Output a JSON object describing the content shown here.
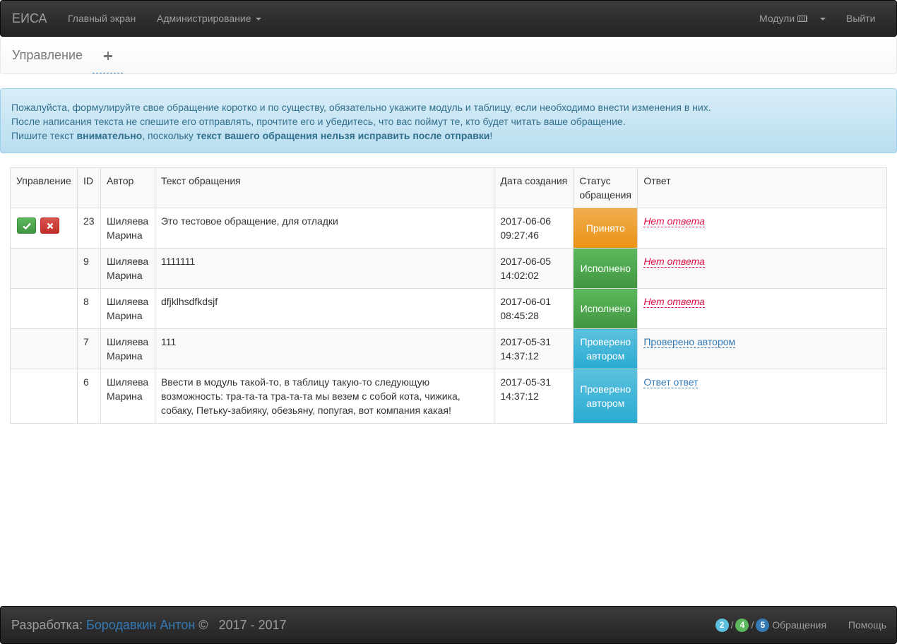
{
  "navbar": {
    "brand": "ЕИСА",
    "home": "Главный экран",
    "admin": "Администрирование",
    "modules": "Модули",
    "logout": "Выйти"
  },
  "subnav": {
    "title": "Управление"
  },
  "alert": {
    "line1": "Пожалуйста, формулируйте свое обращение коротко и по существу, обязательно укажите модуль и таблицу, если необходимо внести изменения в них.",
    "line2": "После написания текста не спешите его отправлять, прочтите его и убедитесь, что вас поймут те, кто будет читать ваше обращение.",
    "line3_a": "Пишите текст ",
    "line3_b": "внимательно",
    "line3_c": ", поскольку ",
    "line3_d": "текст вашего обращения нельзя исправить после отправки",
    "line3_e": "!"
  },
  "table": {
    "headers": [
      "Управление",
      "ID",
      "Автор",
      "Текст обращения",
      "Дата создания",
      "Статус обращения",
      "Ответ"
    ],
    "rows": [
      {
        "id": "23",
        "author": "Шиляева Марина",
        "text": "Это тестовое обращение, для отладки",
        "date": "2017-06-06 09:27:46",
        "status": "Принято",
        "answer": "Нет ответа"
      },
      {
        "id": "9",
        "author": "Шиляева Марина",
        "text": "1111111",
        "date": "2017-06-05 14:02:02",
        "status": "Исполнено",
        "answer": "Нет ответа"
      },
      {
        "id": "8",
        "author": "Шиляева Марина",
        "text": "dfjklhsdfkdsjf",
        "date": "2017-06-01 08:45:28",
        "status": "Исполнено",
        "answer": "Нет ответа"
      },
      {
        "id": "7",
        "author": "Шиляева Марина",
        "text": "111",
        "date": "2017-05-31 14:37:12",
        "status": "Проверено автором",
        "answer": "Проверено автором"
      },
      {
        "id": "6",
        "author": "Шиляева Марина",
        "text": "Ввести в модуль такой-то, в таблицу такую-то следующую возможность: тра-та-та тра-та-та мы везем с собой кота, чижика, собаку, Петьку-забияку, обезьяну, попугая, вот компания какая!",
        "date": "2017-05-31 14:37:12",
        "status": "Проверено автором",
        "answer": "Ответ ответ"
      }
    ]
  },
  "footer": {
    "dev_label": "Разработка: ",
    "author": "Бородавкин Антон",
    "copy": " ©   2017 - 2017",
    "badge1": "2",
    "badge2": "4",
    "badge3": "5",
    "slash": "/",
    "requests": "Обращения",
    "help": "Помощь"
  },
  "icons": {
    "accept": "check-icon",
    "reject": "close-icon",
    "add": "plus-icon",
    "keyboard": "keyboard-icon"
  }
}
